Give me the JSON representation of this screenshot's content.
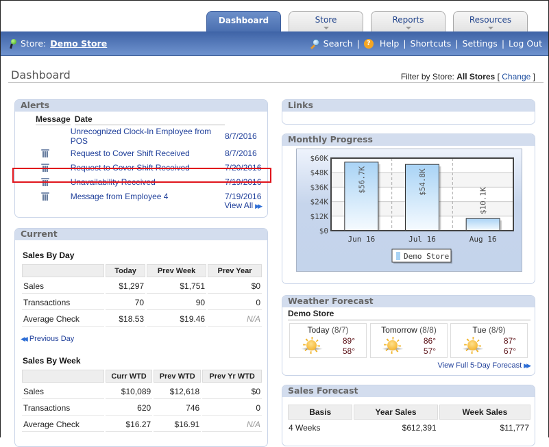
{
  "tabs": [
    {
      "label": "Dashboard",
      "active": true
    },
    {
      "label": "Store",
      "active": false
    },
    {
      "label": "Reports",
      "active": false
    },
    {
      "label": "Resources",
      "active": false
    }
  ],
  "navbar": {
    "store_prefix": "Store:",
    "store_name": "Demo Store",
    "links": {
      "search": "Search",
      "help": "Help",
      "shortcuts": "Shortcuts",
      "settings": "Settings",
      "logout": "Log Out"
    },
    "separator": "|"
  },
  "page": {
    "title": "Dashboard",
    "filter_label": "Filter by Store:",
    "filter_value": "All Stores",
    "bracket_open": "[",
    "change": "Change",
    "bracket_close": "]"
  },
  "alerts": {
    "title": "Alerts",
    "columns": {
      "message": "Message",
      "date": "Date"
    },
    "rows": [
      {
        "message": "Unrecognized Clock-In Employee from POS",
        "date": "8/7/2016",
        "deletable": false,
        "highlighted": false
      },
      {
        "message": "Request to Cover Shift Received",
        "date": "8/7/2016",
        "deletable": true,
        "highlighted": false
      },
      {
        "message": "Request to Cover Shift Received",
        "date": "7/20/2016",
        "deletable": true,
        "highlighted": false
      },
      {
        "message": "Unavailability Received",
        "date": "7/19/2016",
        "deletable": true,
        "highlighted": true
      },
      {
        "message": "Message from Employee 4",
        "date": "7/19/2016",
        "deletable": true,
        "highlighted": false
      }
    ],
    "view_all": "View All"
  },
  "current": {
    "title": "Current",
    "by_day": {
      "title": "Sales By Day",
      "columns": [
        "",
        "Today",
        "Prev Week",
        "Prev Year"
      ],
      "rows": [
        [
          "Sales",
          "$1,297",
          "$1,751",
          "$0"
        ],
        [
          "Transactions",
          "70",
          "90",
          "0"
        ],
        [
          "Average Check",
          "$18.53",
          "$19.46",
          "N/A"
        ]
      ],
      "previous_day": "Previous Day"
    },
    "by_week": {
      "title": "Sales By Week",
      "columns": [
        "",
        "Curr WTD",
        "Prev WTD",
        "Prev Yr WTD"
      ],
      "rows": [
        [
          "Sales",
          "$10,089",
          "$12,618",
          "$0"
        ],
        [
          "Transactions",
          "620",
          "746",
          "0"
        ],
        [
          "Average Check",
          "$16.27",
          "$16.91",
          "N/A"
        ]
      ]
    }
  },
  "links": {
    "title": "Links"
  },
  "monthly": {
    "title": "Monthly Progress"
  },
  "chart_data": {
    "type": "bar",
    "title": "Monthly Progress",
    "categories": [
      "Jun 16",
      "Jul 16",
      "Aug 16"
    ],
    "series": [
      {
        "name": "Demo Store",
        "values": [
          56700,
          54800,
          10100
        ],
        "labels": [
          "$56.7K",
          "$54.8K",
          "$10.1K"
        ],
        "color": "#a9d3f5"
      }
    ],
    "y_ticks": [
      "$0",
      "$12K",
      "$24K",
      "$36K",
      "$48K",
      "$60K"
    ],
    "ylim": [
      0,
      60000
    ],
    "xlabel": "",
    "ylabel": "",
    "grid": true,
    "legend": "bottom-center"
  },
  "weather": {
    "title": "Weather Forecast",
    "store": "Demo Store",
    "days": [
      {
        "day": "Today",
        "date": "(8/7)",
        "high": "89°",
        "low": "58°",
        "icon": "sunny-icon"
      },
      {
        "day": "Tomorrow",
        "date": "(8/8)",
        "high": "86°",
        "low": "57°",
        "icon": "sunny-icon"
      },
      {
        "day": "Tue",
        "date": "(8/9)",
        "high": "87°",
        "low": "67°",
        "icon": "sunny-icon"
      }
    ],
    "full_link": "View Full 5-Day Forecast"
  },
  "forecast": {
    "title": "Sales Forecast",
    "columns": [
      "Basis",
      "Year Sales",
      "Week Sales"
    ],
    "rows": [
      [
        "4 Weeks",
        "$612,391",
        "$11,777"
      ]
    ]
  },
  "colors": {
    "nav_blue": "#4a6fb0",
    "link_blue": "#1f3f9a",
    "highlight_red": "#e0141c",
    "bar_fill": "#a9d3f5"
  }
}
